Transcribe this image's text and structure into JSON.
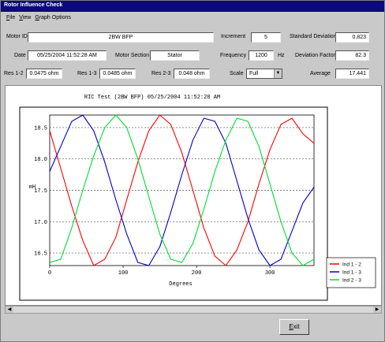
{
  "window": {
    "title": "Rotor Influence Check"
  },
  "menu": [
    {
      "label": "File",
      "key": "F",
      "rest": "ile"
    },
    {
      "label": "View",
      "key": "V",
      "rest": "iew"
    },
    {
      "label": "Graph Options",
      "key": "G",
      "rest": "raph Options"
    }
  ],
  "form": {
    "motor_id_label": "Motor ID",
    "motor_id": "2BW BFP",
    "increment_label": "Increment",
    "increment": "5",
    "std_dev_label": "Standard Deviation",
    "std_dev": "0.823",
    "date_label": "Date",
    "date": "05/25/2004 11:52:28 AM",
    "motor_section_label": "Motor Section",
    "motor_section": "Stator",
    "frequency_label": "Frequency",
    "frequency": "1200",
    "frequency_unit": "Hz",
    "deviation_factor_label": "Deviation Factor",
    "deviation_factor": "82.3",
    "res12_label": "Res 1-2",
    "res12": "0.0475 ohm",
    "res13_label": "Res 1-3",
    "res13": "0.0485 ohm",
    "res23_label": "Res 2-3",
    "res23": "0.048 ohm",
    "scale_label": "Scale",
    "scale": "Full",
    "average_label": "Average",
    "average": "17.441"
  },
  "buttons": {
    "exit": "Exit",
    "exit_key": "E",
    "exit_rest": "xit"
  },
  "chart_data": {
    "type": "line",
    "title": "RIC Test (2BW BFP) 05/25/2004 11:52:28 AM",
    "xlabel": "Degrees",
    "ylabel": "mH",
    "xlim": [
      0,
      360
    ],
    "ylim": [
      16.3,
      18.7
    ],
    "xticks": [
      0,
      100,
      200,
      300
    ],
    "yticks": [
      16.5,
      17.0,
      17.5,
      18.0,
      18.5
    ],
    "ytick_labels": [
      "16.5",
      "17.0",
      "17.5",
      "18.0",
      "18.5"
    ],
    "grid": "horizontal dotted",
    "legend_position": "right",
    "x": [
      0,
      15,
      30,
      45,
      60,
      75,
      90,
      105,
      120,
      135,
      150,
      165,
      180,
      195,
      210,
      225,
      240,
      255,
      270,
      285,
      300,
      315,
      330,
      345,
      360
    ],
    "series": [
      {
        "name": "Ind 1 - 2",
        "color": "#ff0000",
        "values": [
          18.45,
          17.85,
          17.25,
          16.7,
          16.3,
          16.4,
          16.75,
          17.35,
          17.95,
          18.45,
          18.7,
          18.55,
          18.1,
          17.5,
          16.9,
          16.45,
          16.3,
          16.55,
          17.0,
          17.6,
          18.15,
          18.55,
          18.65,
          18.4,
          18.25
        ]
      },
      {
        "name": "Ind 1 - 3",
        "color": "#0000cc",
        "values": [
          17.8,
          18.2,
          18.6,
          18.7,
          18.45,
          17.95,
          17.35,
          16.8,
          16.35,
          16.3,
          16.6,
          17.15,
          17.75,
          18.3,
          18.65,
          18.6,
          18.25,
          17.65,
          17.05,
          16.55,
          16.3,
          16.4,
          16.85,
          17.3,
          17.55
        ]
      },
      {
        "name": "Ind 2 - 3",
        "color": "#00dd33",
        "values": [
          16.35,
          16.4,
          16.9,
          17.5,
          18.05,
          18.5,
          18.7,
          18.5,
          18.0,
          17.4,
          16.8,
          16.4,
          16.35,
          16.65,
          17.2,
          17.8,
          18.3,
          18.65,
          18.6,
          18.2,
          17.6,
          17.0,
          16.5,
          16.3,
          16.4
        ]
      }
    ]
  }
}
